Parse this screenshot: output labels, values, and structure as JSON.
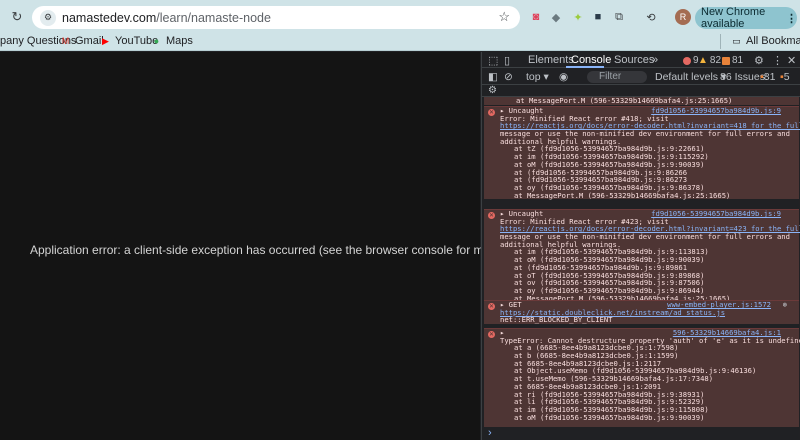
{
  "browser": {
    "url_host": "namastedev.com",
    "url_path": "/learn/namaste-node",
    "new_chrome_label": "New Chrome available",
    "avatar_letter": "R"
  },
  "bookmarks": {
    "items": [
      {
        "label": "pany Questions"
      },
      {
        "label": "Gmail"
      },
      {
        "label": "YouTube"
      },
      {
        "label": "Maps"
      }
    ],
    "all_bookmarks": "All Bookmarks"
  },
  "page": {
    "error_text": "Application error: a client-side exception has occurred (see the browser console for more information)."
  },
  "devtools": {
    "tabs": [
      "Elements",
      "Console",
      "Sources"
    ],
    "error_count": "9",
    "warning_count": "82",
    "info_count": "81",
    "context": "top",
    "filter_placeholder": "Filter",
    "levels": "Default levels",
    "issues_label": "86 Issues:",
    "issues_errors": "81",
    "issues_info": "5"
  },
  "console": {
    "top_line": "at MessagePort.M (596-53329b14669bafa4.js:25:1665)",
    "messages": [
      {
        "head": "Uncaught",
        "source": "fd9d1056-53994657ba984d9b.js:9",
        "body": [
          "Error: Minified React error #418; visit",
          "https://reactjs.org/docs/error-decoder.html?invariant=418 for the full",
          "message or use the non-minified dev environment for full errors and",
          "additional helpful warnings."
        ],
        "stack": [
          "at tZ (fd9d1056-53994657ba984d9b.js:9:22661)",
          "at im (fd9d1056-53994657ba984d9b.js:9:115292)",
          "at oM (fd9d1056-53994657ba984d9b.js:9:90039)",
          "at (fd9d1056-53994657ba984d9b.js:9:86266",
          "at (fd9d1056-53994657ba984d9b.js:9:86273",
          "at oy (fd9d1056-53994657ba984d9b.js:9:86378)",
          "at MessagePort.M (596-53329b14669bafa4.js:25:1665)"
        ]
      },
      {
        "head": "Uncaught",
        "source": "fd9d1056-53994657ba984d9b.js:9",
        "body": [
          "Error: Minified React error #423; visit",
          "https://reactjs.org/docs/error-decoder.html?invariant=423 for the full",
          "message or use the non-minified dev environment for full errors and",
          "additional helpful warnings."
        ],
        "stack": [
          "at im (fd9d1056-53994657ba984d9b.js:9:113813)",
          "at oM (fd9d1056-53994657ba984d9b.js:9:90039)",
          "at (fd9d1056-53994657ba984d9b.js:9:89861",
          "at oT (fd9d1056-53994657ba984d9b.js:9:89868)",
          "at ov (fd9d1056-53994657ba984d9b.js:9:87506)",
          "at oy (fd9d1056-53994657ba984d9b.js:9:86944)",
          "at MessagePort.M (596-53329b14669bafa4.js:25:1665)"
        ]
      },
      {
        "head": "GET",
        "source": "www-embed-player.js:1572",
        "body": [
          "https://static.doubleclick.net/instream/ad_status.js",
          "net::ERR_BLOCKED_BY_CLIENT"
        ],
        "stack": []
      },
      {
        "head": "",
        "source": "596-53329b14669bafa4.js:1",
        "body": [
          "TypeError: Cannot destructure property 'auth' of 'e' as it is undefined."
        ],
        "stack": [
          "at a (6685-8ee4b9a8123dcbe0.js:1:7598)",
          "at b (6685-8ee4b9a8123dcbe0.js:1:1599)",
          "at 6685-8ee4b9a8123dcbe0.js:1:2117",
          "at Object.useMemo (fd9d1056-53994657ba984d9b.js:9:46136)",
          "at t.useMemo (596-53329b14669bafa4.js:17:7348)",
          "at 6685-8ee4b9a8123dcbe0.js:1:2091",
          "at ri (fd9d1056-53994657ba984d9b.js:9:38931)",
          "at li (fd9d1056-53994657ba984d9b.js:9:52329)",
          "at im (fd9d1056-53994657ba984d9b.js:9:115808)",
          "at oM (fd9d1056-53994657ba984d9b.js:9:90039)"
        ]
      }
    ],
    "prompt": "›"
  },
  "colors": {
    "error_bg": "#4e3534",
    "link": "#8ab4f8",
    "chrome_toolbar": "#cfe3e7"
  }
}
